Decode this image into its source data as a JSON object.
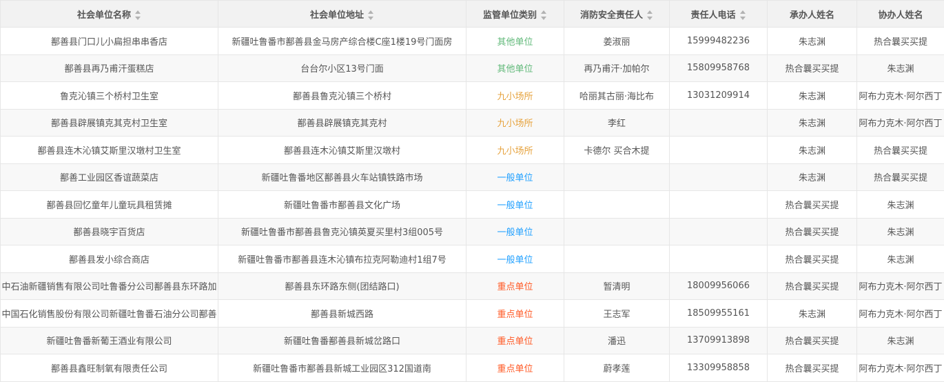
{
  "columns": [
    {
      "label": "社会单位名称",
      "sortable": true
    },
    {
      "label": "社会单位地址",
      "sortable": true
    },
    {
      "label": "监管单位类别",
      "sortable": true
    },
    {
      "label": "消防安全责任人",
      "sortable": true
    },
    {
      "label": "责任人电话",
      "sortable": true
    },
    {
      "label": "承办人姓名",
      "sortable": false
    },
    {
      "label": "协办人姓名",
      "sortable": false
    }
  ],
  "category_colors": {
    "其他单位": "#5fb878",
    "九小场所": "#e6a23c",
    "一般单位": "#1e9fff",
    "重点单位": "#ff5722"
  },
  "rows": [
    {
      "name": "鄯善县门口儿小扁担串串香店",
      "address": "新疆吐鲁番市鄯善县金马房产综合楼C座1楼19号门面房",
      "category": "其他单位",
      "person": "姜淑丽",
      "phone": "15999482236",
      "handler": "朱志渊",
      "assistant": "热合曩买买提"
    },
    {
      "name": "鄯善县再乃甫汗蛋糕店",
      "address": "台台尔小区13号门面",
      "category": "其他单位",
      "person": "再乃甫汗·加帕尔",
      "phone": "15809958768",
      "handler": "热合曩买买提",
      "assistant": "朱志渊"
    },
    {
      "name": "鲁克沁镇三个桥村卫生室",
      "address": "鄯善县鲁克沁镇三个桥村",
      "category": "九小场所",
      "person": "哈丽其古丽·海比布",
      "phone": "13031209914",
      "handler": "朱志渊",
      "assistant": "阿布力克木·阿尔西丁"
    },
    {
      "name": "鄯善县辟展镇克其克村卫生室",
      "address": "鄯善县辟展镇克其克村",
      "category": "九小场所",
      "person": "李红",
      "phone": "",
      "handler": "朱志渊",
      "assistant": "阿布力克木·阿尔西丁"
    },
    {
      "name": "鄯善县连木沁镇艾斯里汉墩村卫生室",
      "address": "鄯善县连木沁镇艾斯里汉墩村",
      "category": "九小场所",
      "person": "卡德尔 买合木提",
      "phone": "",
      "handler": "朱志渊",
      "assistant": "热合曩买买提"
    },
    {
      "name": "鄯善工业园区香谊蔬菜店",
      "address": "新疆吐鲁番地区鄯善县火车站镇铁路市场",
      "category": "一般单位",
      "person": "",
      "phone": "",
      "handler": "朱志渊",
      "assistant": "热合曩买买提"
    },
    {
      "name": "鄯善县回忆童年儿童玩具租赁摊",
      "address": "新疆吐鲁番市鄯善县文化广场",
      "category": "一般单位",
      "person": "",
      "phone": "",
      "handler": "热合曩买买提",
      "assistant": "朱志渊"
    },
    {
      "name": "鄯善县晓宇百货店",
      "address": "新疆吐鲁番市鄯善县鲁克沁镇英夏买里村3组005号",
      "category": "一般单位",
      "person": "",
      "phone": "",
      "handler": "热合曩买买提",
      "assistant": "朱志渊"
    },
    {
      "name": "鄯善县发小综合商店",
      "address": "新疆吐鲁番市鄯善县连木沁镇布拉克阿勒迪村1组7号",
      "category": "一般单位",
      "person": "",
      "phone": "",
      "handler": "热合曩买买提",
      "assistant": "朱志渊"
    },
    {
      "name": "中石油新疆销售有限公司吐鲁番分公司鄯善县东环路加",
      "address": "鄯善县东环路东侧(团结路口)",
      "category": "重点单位",
      "person": "暂清明",
      "phone": "18009956066",
      "handler": "热合曩买买提",
      "assistant": "阿布力克木·阿尔西丁"
    },
    {
      "name": "中国石化销售股份有限公司新疆吐鲁番石油分公司鄯善",
      "address": "鄯善县新城西路",
      "category": "重点单位",
      "person": "王志军",
      "phone": "18509955161",
      "handler": "朱志渊",
      "assistant": "阿布力克木·阿尔西丁"
    },
    {
      "name": "新疆吐鲁番新葡王酒业有限公司",
      "address": "新疆吐鲁番鄯善县新城岔路口",
      "category": "重点单位",
      "person": "潘迅",
      "phone": "13709913898",
      "handler": "热合曩买买提",
      "assistant": "朱志渊"
    },
    {
      "name": "鄯善县鑫旺制氧有限责任公司",
      "address": "新疆吐鲁番市鄯善县新城工业园区312国道南",
      "category": "重点单位",
      "person": "蔚孝莲",
      "phone": "13309958858",
      "handler": "热合曩买买提",
      "assistant": "阿布力克木·阿尔西丁"
    }
  ]
}
